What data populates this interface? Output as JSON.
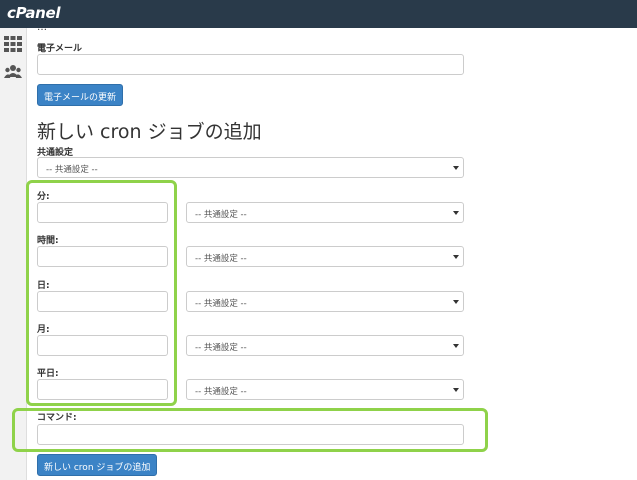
{
  "header": {
    "logo": "cPanel"
  },
  "sidebar": {
    "icons": [
      "grid-icon",
      "users-icon"
    ]
  },
  "email_section": {
    "cut_label": "…",
    "label": "電子メール",
    "email_value": "",
    "update_button": "電子メールの更新"
  },
  "add_cron": {
    "heading": "新しい cron ジョブの追加",
    "common_settings_label": "共通設定",
    "common_settings_value": "-- 共通設定 --",
    "fields": [
      {
        "label": "分:",
        "value": "",
        "select": "-- 共通設定 --"
      },
      {
        "label": "時間:",
        "value": "",
        "select": "-- 共通設定 --"
      },
      {
        "label": "日:",
        "value": "",
        "select": "-- 共通設定 --"
      },
      {
        "label": "月:",
        "value": "",
        "select": "-- 共通設定 --"
      },
      {
        "label": "平日:",
        "value": "",
        "select": "-- 共通設定 --"
      }
    ],
    "command_label": "コマンド:",
    "command_value": "",
    "submit_button": "新しい cron ジョブの追加"
  },
  "colors": {
    "topbar": "#293a4a",
    "button": "#3b83c6",
    "highlight": "#8fd24a"
  }
}
